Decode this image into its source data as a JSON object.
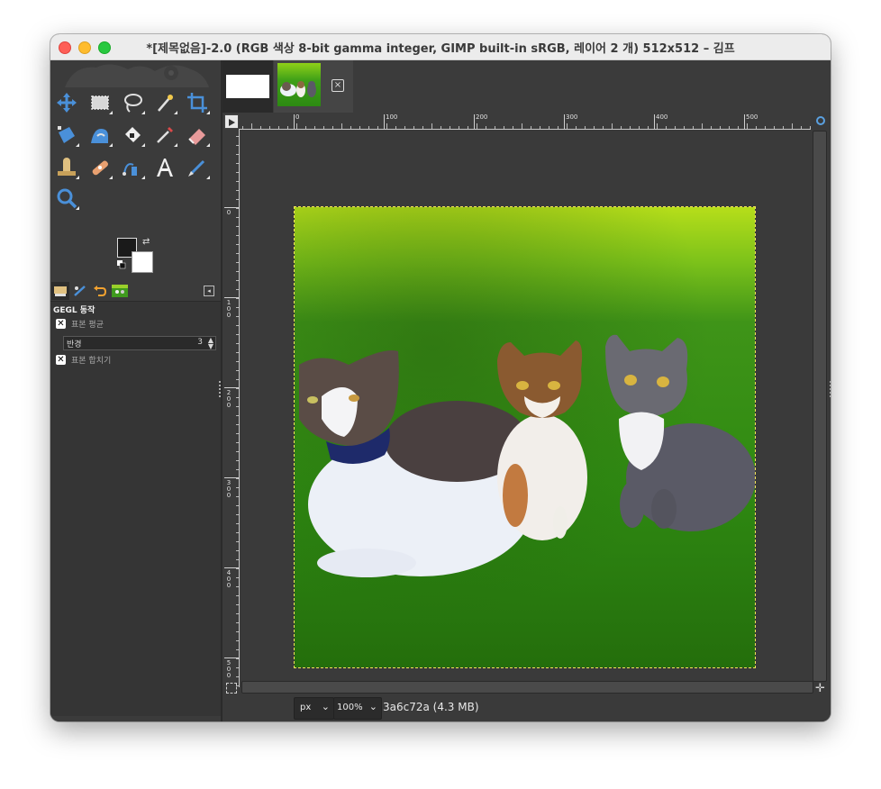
{
  "window": {
    "title": "*[제목없음]-2.0 (RGB 색상 8-bit gamma integer, GIMP built-in sRGB, 레이어 2 개) 512x512 – 김프"
  },
  "toolbox": {
    "tools": [
      "move-tool",
      "rect-select-tool",
      "free-select-tool",
      "fuzzy-select-tool",
      "crop-tool",
      "unified-transform-tool",
      "warp-transform-tool",
      "bucket-fill-tool",
      "color-picker-tool",
      "eraser-tool",
      "clone-tool",
      "heal-tool",
      "paths-tool",
      "text-tool",
      "paintbrush-tool",
      "zoom-tool"
    ],
    "colors": {
      "foreground": "#1a1a1a",
      "background": "#ffffff"
    }
  },
  "tool_options": {
    "title": "GEGL 동작",
    "sample_average_label": "표본 평균",
    "radius_label": "반경",
    "radius_value": "3",
    "sample_merged_label": "표본 합치기"
  },
  "ruler": {
    "h_labels": [
      "0",
      "100",
      "200",
      "300",
      "400",
      "500"
    ],
    "v_labels": [
      "0",
      "1\n0\n0",
      "2\n0\n0",
      "3\n0\n0",
      "4\n0\n0",
      "5\n0\n0"
    ]
  },
  "image_tabs": {
    "close_symbol": "×"
  },
  "status": {
    "unit": "px",
    "zoom": "100%",
    "message": "3a6c72a (4.3 MB)"
  },
  "colors": {
    "accent": "#5aa0e0",
    "panel": "#3b3b3b",
    "selection": "#f4e45a"
  }
}
